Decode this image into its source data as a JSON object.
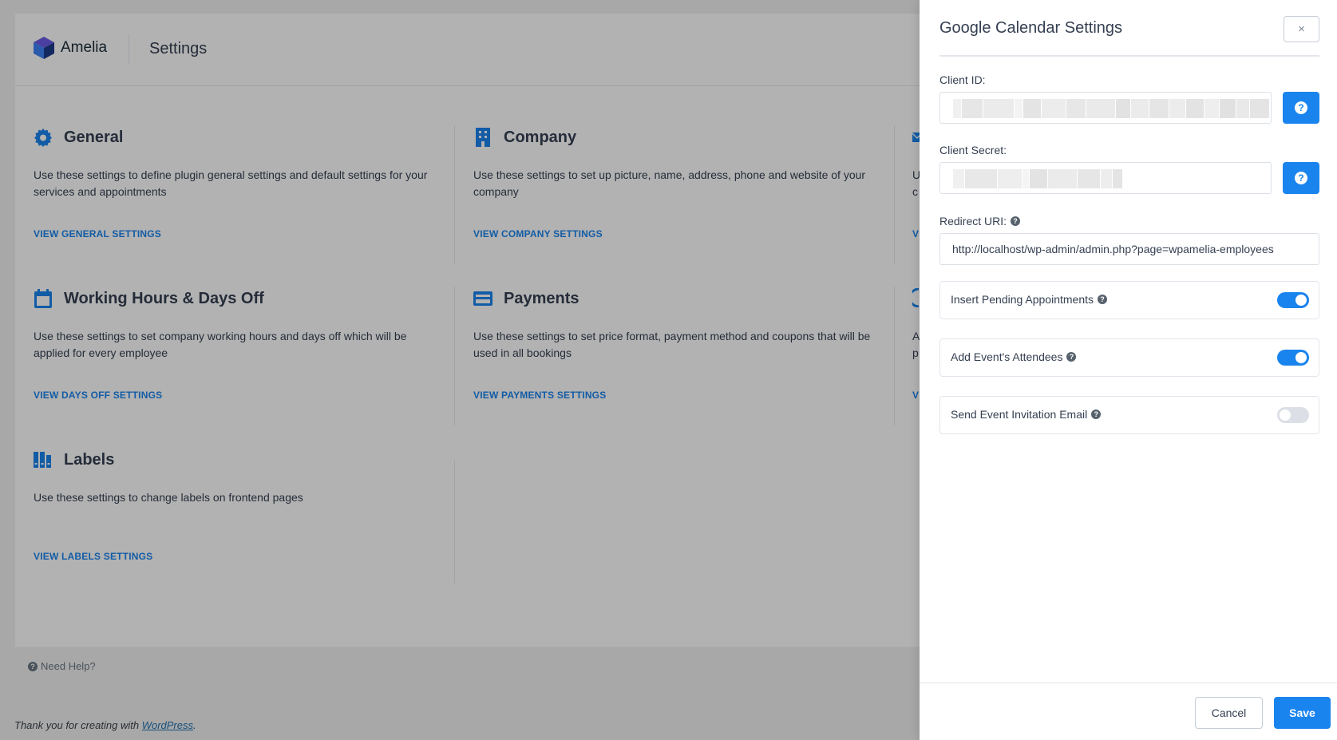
{
  "app": {
    "logo_text": "Amelia",
    "page_title": "Settings"
  },
  "settings": [
    {
      "title": "General",
      "icon": "gear-icon",
      "description": "Use these settings to define plugin general settings and default settings for your services and appointments",
      "link": "VIEW GENERAL SETTINGS"
    },
    {
      "title": "Company",
      "icon": "building-icon",
      "description": "Use these settings to set up picture, name, address, phone and website of your company",
      "link": "VIEW COMPANY SETTINGS"
    },
    {
      "title": "Working Hours & Days Off",
      "icon": "calendar-icon",
      "description": "Use these settings to set company working hours and days off which will be applied for every employee",
      "link": "VIEW DAYS OFF SETTINGS"
    },
    {
      "title": "Payments",
      "icon": "credit-card-icon",
      "description": "Use these settings to set price format, payment method and coupons that will be used in all bookings",
      "link": "VIEW PAYMENTS SETTINGS"
    },
    {
      "title": "Labels",
      "icon": "books-icon",
      "description": "Use these settings to change labels on frontend pages",
      "link": "VIEW LABELS SETTINGS"
    }
  ],
  "partial_column": {
    "row1_letters": [
      "U",
      "c"
    ],
    "row1_link": "V",
    "row2_letters": [
      "A",
      "p"
    ],
    "row2_link": "V"
  },
  "footer": {
    "need_help": "Need Help?",
    "thanks_prefix": "Thank you for creating with ",
    "thanks_link": "WordPress",
    "thanks_suffix": "."
  },
  "dialog": {
    "title": "Google Calendar Settings",
    "close_label": "×",
    "client_id_label": "Client ID:",
    "client_secret_label": "Client Secret:",
    "redirect_uri_label": "Redirect URI:",
    "redirect_uri_value": "http://localhost/wp-admin/admin.php?page=wpamelia-employees",
    "toggles": [
      {
        "label": "Insert Pending Appointments",
        "on": true
      },
      {
        "label": "Add Event's Attendees",
        "on": true
      },
      {
        "label": "Send Event Invitation Email",
        "on": false
      }
    ],
    "cancel_label": "Cancel",
    "save_label": "Save"
  },
  "colors": {
    "accent": "#1a84ee",
    "text": "#354052",
    "icon_blue": "#1a84ee"
  }
}
